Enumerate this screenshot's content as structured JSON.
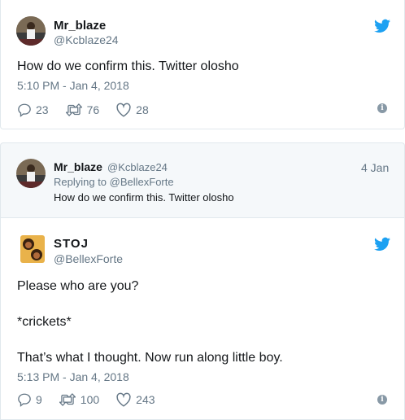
{
  "tweet1": {
    "name": "Mr_blaze",
    "handle": "@Kcblaze24",
    "text": "How do we confirm this. Twitter olosho",
    "timestamp": "5:10 PM - Jan 4, 2018",
    "replies": "23",
    "retweets": "76",
    "likes": "28"
  },
  "reply": {
    "name": "Mr_blaze",
    "handle": "@Kcblaze24",
    "date": "4 Jan",
    "replying_to": "Replying to @BellexForte",
    "text": "How do we confirm this. Twitter olosho"
  },
  "tweet2": {
    "name": "STOJ",
    "handle": "@BellexForte",
    "line1": "Please who are you?",
    "line2": "*crickets*",
    "line3": "That’s what I thought. Now run along little boy.",
    "timestamp": "5:13 PM - Jan 4, 2018",
    "replies": "9",
    "retweets": "100",
    "likes": "243"
  },
  "icons": {
    "brand": "twitter-bird-icon",
    "reply": "reply-icon",
    "retweet": "retweet-icon",
    "like": "heart-icon",
    "info": "info-icon"
  },
  "colors": {
    "twitter_blue": "#1da1f2",
    "secondary_text": "#657786",
    "border": "#e1e8ed"
  }
}
